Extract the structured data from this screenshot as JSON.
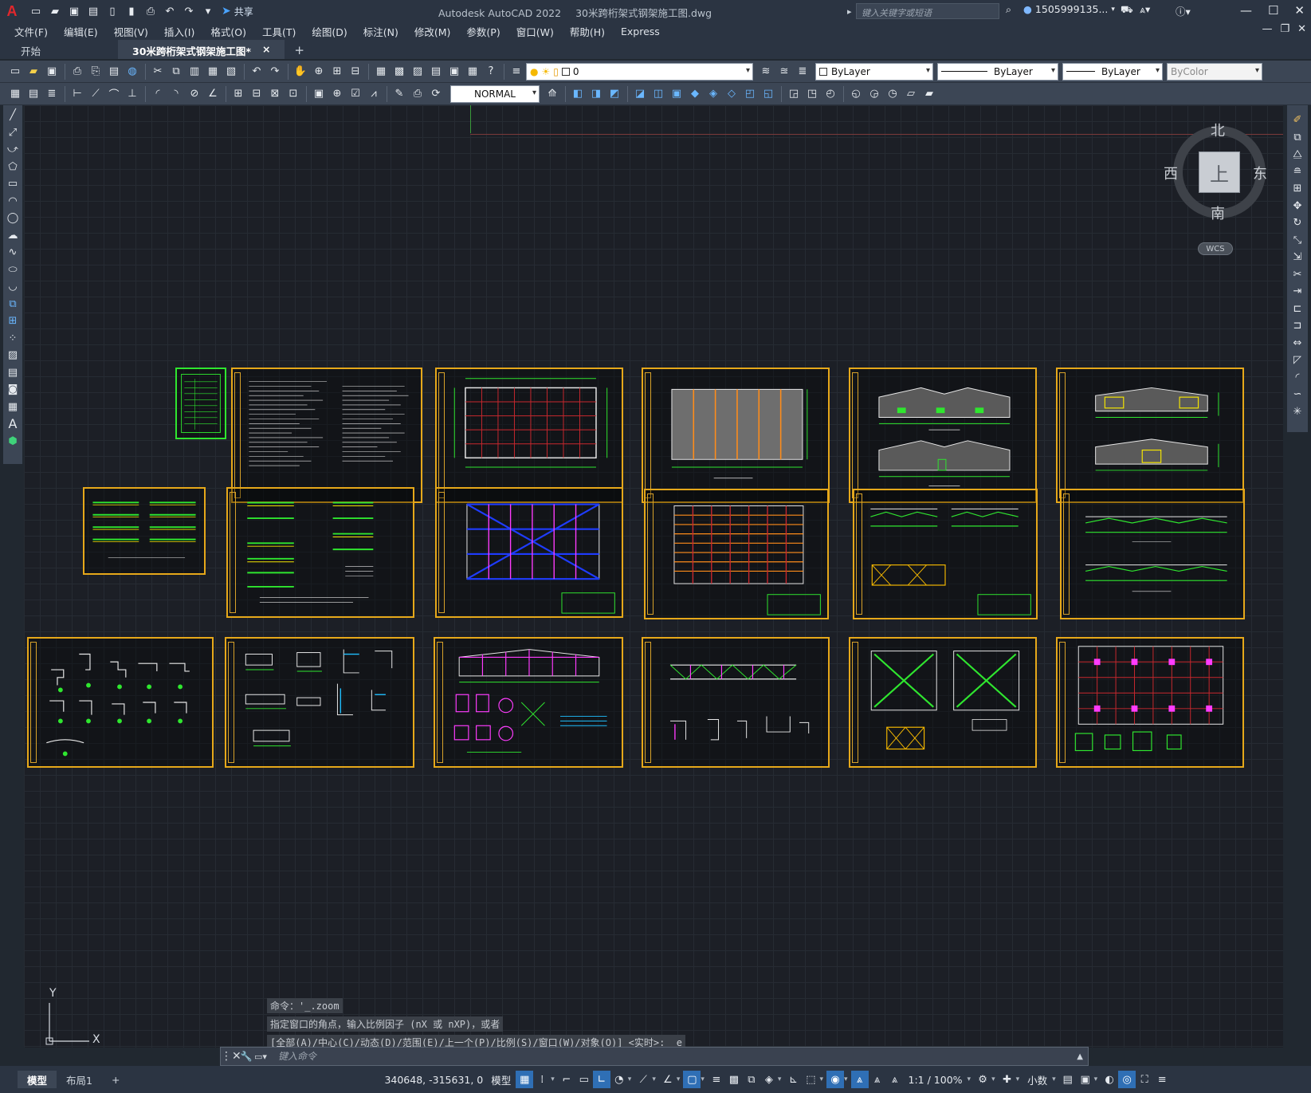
{
  "title_bar": {
    "app_name": "Autodesk AutoCAD 2022",
    "file_name": "30米跨桁架式钢架施工图.dwg",
    "share_label": "共享",
    "search_placeholder": "键入关键字或短语",
    "user_name": "1505999135..."
  },
  "menu": [
    "文件(F)",
    "编辑(E)",
    "视图(V)",
    "插入(I)",
    "格式(O)",
    "工具(T)",
    "绘图(D)",
    "标注(N)",
    "修改(M)",
    "参数(P)",
    "窗口(W)",
    "帮助(H)",
    "Express"
  ],
  "tabs": {
    "start": "开始",
    "active": "30米跨桁架式钢架施工图*",
    "close": "×",
    "new": "+"
  },
  "toolbar": {
    "layer_value": "0",
    "color_value": "ByLayer",
    "linetype_value": "ByLayer",
    "lineweight_value": "ByLayer",
    "plotstyle_value": "ByColor",
    "dimstyle_value": "NORMAL"
  },
  "viewcube": {
    "top": "上",
    "north": "北",
    "south": "南",
    "east": "东",
    "west": "西",
    "wcs": "WCS"
  },
  "ucs": {
    "x": "X",
    "y": "Y"
  },
  "command": {
    "history": [
      "命令：'_.zoom",
      "指定窗口的角点，输入比例因子 (nX 或 nXP)，或者",
      "[全部(A)/中心(C)/动态(D)/范围(E)/上一个(P)/比例(S)/窗口(W)/对象(O)] <实时>: _e"
    ],
    "input_placeholder": "键入命令"
  },
  "status": {
    "layout_tabs": [
      "模型",
      "布局1"
    ],
    "add_layout": "+",
    "coordinates": "340648, -315631, 0",
    "space": "模型",
    "scale": "1:1 / 100%",
    "units": "小数"
  },
  "colors": {
    "sheet_border": "#e6a81a",
    "grid_red": "#c8282e",
    "line_green": "#2fe62f",
    "accent_blue": "#2f6fb5"
  }
}
